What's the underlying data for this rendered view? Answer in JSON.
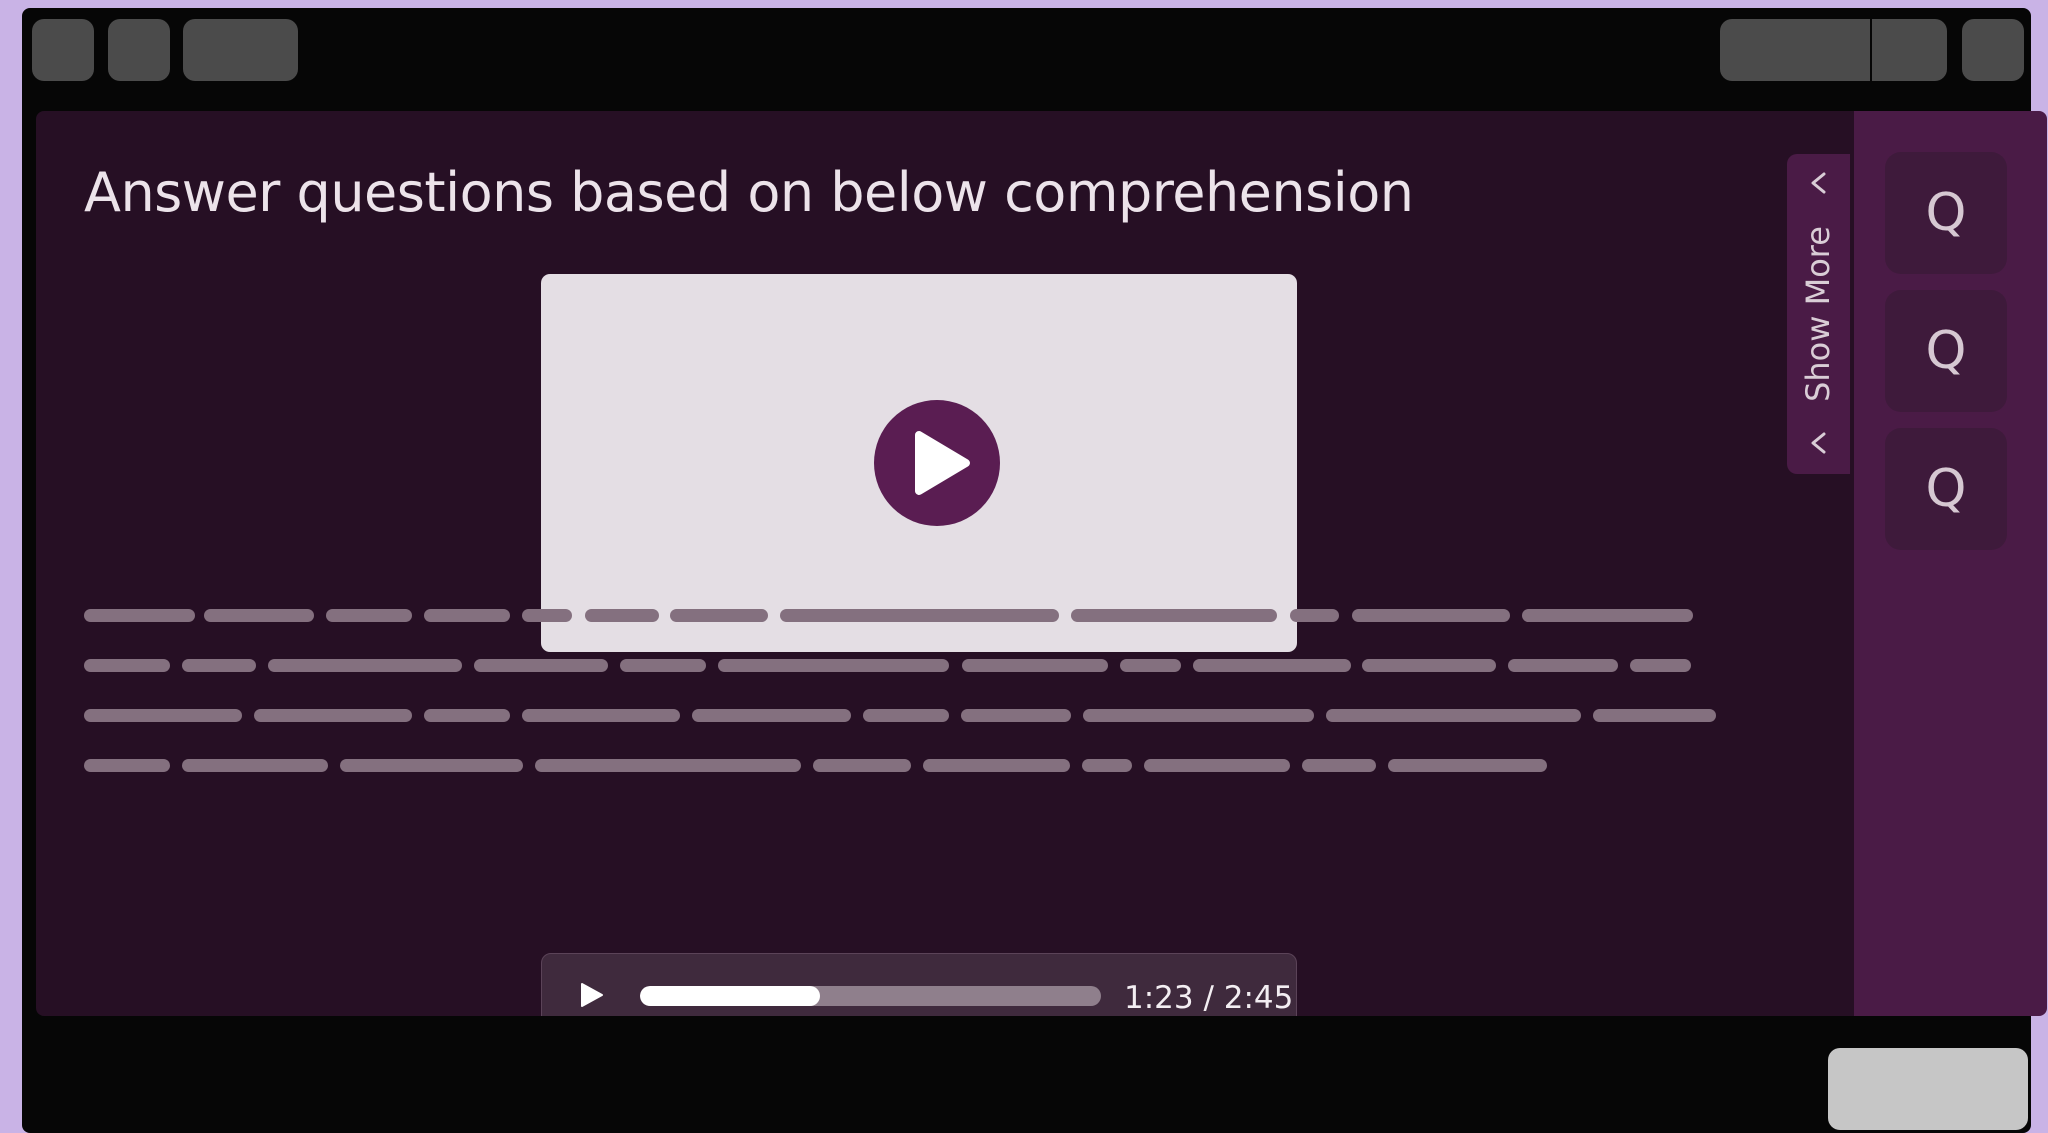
{
  "page": {
    "title": "Answer questions based on below comprehension"
  },
  "video": {
    "play_icon": "play-icon"
  },
  "audio": {
    "time": "1:23 / 2:45",
    "progress": 0.39,
    "play_icon": "play-icon"
  },
  "sidebar": {
    "show_more_label": "Show More",
    "questions": [
      {
        "label": "Q"
      },
      {
        "label": "Q"
      },
      {
        "label": "Q"
      }
    ]
  },
  "colors": {
    "background": "#c9b3e6",
    "panel": "#260f24",
    "accent": "#5a1d52",
    "sidebar": "#4a1b46"
  }
}
